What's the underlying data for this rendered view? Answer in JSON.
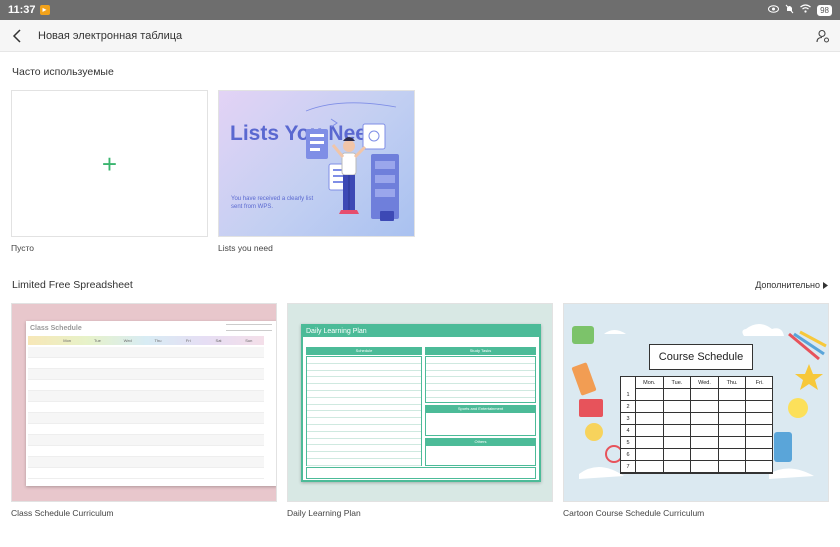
{
  "status": {
    "time": "11:37",
    "battery": "98"
  },
  "header": {
    "title": "Новая электронная таблица"
  },
  "frequent": {
    "title": "Часто используемые",
    "items": [
      {
        "label": "Пусто"
      },
      {
        "label": "Lists you need",
        "thumb_title": "Lists You Need",
        "thumb_text": "You have received a clearly list sent from WPS."
      }
    ]
  },
  "limited": {
    "title": "Limited Free Spreadsheet",
    "more_label": "Дополнительно",
    "items": [
      {
        "label": "Class Schedule Curriculum",
        "thumb_title": "Class Schedule",
        "days": [
          "Mon",
          "Tue",
          "Wed",
          "Thu",
          "Fri",
          "Sat",
          "Sun"
        ]
      },
      {
        "label": "Daily Learning Plan",
        "thumb_title": "Daily Learning Plan",
        "headers": [
          "Schedule",
          "Study Tasks",
          "Sports and Entertainment",
          "Others"
        ]
      },
      {
        "label": "Cartoon Course Schedule Curriculum",
        "thumb_title": "Course Schedule",
        "days": [
          "Mon.",
          "Tue.",
          "Wed.",
          "Thu.",
          "Fri."
        ],
        "rows": [
          "1",
          "2",
          "3",
          "4",
          "5",
          "6",
          "7"
        ]
      }
    ]
  },
  "colors": {
    "accent": "#3ab56f",
    "wps_blue": "#5a68d0",
    "teal": "#4cbb98"
  }
}
